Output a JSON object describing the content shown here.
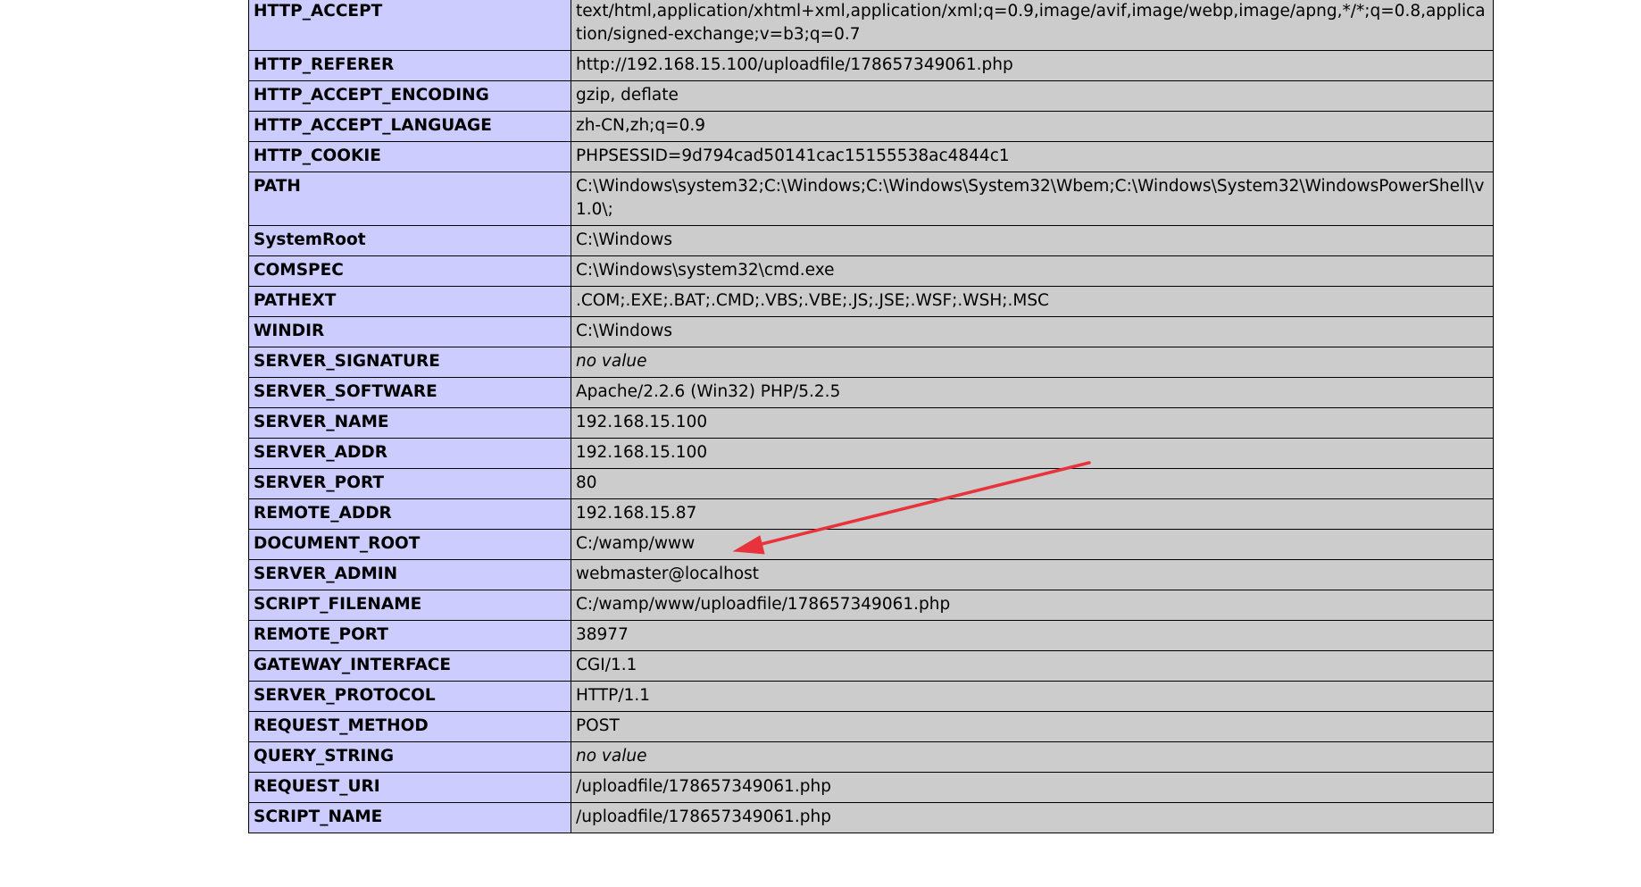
{
  "annotation": {
    "arrow_color": "#e8323c"
  },
  "colors": {
    "key_cell_bg": "#ccccff",
    "value_cell_bg": "#cccccc",
    "border": "#000000"
  },
  "rows": [
    {
      "key": "HTTP_ACCEPT",
      "value": "text/html,application/xhtml+xml,application/xml;q=0.9,image/avif,image/webp,image/apng,*/*;q=0.8,application/signed-exchange;v=b3;q=0.7",
      "no_value": false
    },
    {
      "key": "HTTP_REFERER",
      "value": "http://192.168.15.100/uploadfile/178657349061.php",
      "no_value": false
    },
    {
      "key": "HTTP_ACCEPT_ENCODING",
      "value": "gzip, deflate",
      "no_value": false
    },
    {
      "key": "HTTP_ACCEPT_LANGUAGE",
      "value": "zh-CN,zh;q=0.9",
      "no_value": false
    },
    {
      "key": "HTTP_COOKIE",
      "value": "PHPSESSID=9d794cad50141cac15155538ac4844c1",
      "no_value": false
    },
    {
      "key": "PATH",
      "value": "C:\\Windows\\system32;C:\\Windows;C:\\Windows\\System32\\Wbem;C:\\Windows\\System32\\WindowsPowerShell\\v1.0\\;",
      "no_value": false
    },
    {
      "key": "SystemRoot",
      "value": "C:\\Windows",
      "no_value": false
    },
    {
      "key": "COMSPEC",
      "value": "C:\\Windows\\system32\\cmd.exe",
      "no_value": false
    },
    {
      "key": "PATHEXT",
      "value": ".COM;.EXE;.BAT;.CMD;.VBS;.VBE;.JS;.JSE;.WSF;.WSH;.MSC",
      "no_value": false
    },
    {
      "key": "WINDIR",
      "value": "C:\\Windows",
      "no_value": false
    },
    {
      "key": "SERVER_SIGNATURE",
      "value": "no value",
      "no_value": true
    },
    {
      "key": "SERVER_SOFTWARE",
      "value": "Apache/2.2.6 (Win32) PHP/5.2.5",
      "no_value": false
    },
    {
      "key": "SERVER_NAME",
      "value": "192.168.15.100",
      "no_value": false
    },
    {
      "key": "SERVER_ADDR",
      "value": "192.168.15.100",
      "no_value": false
    },
    {
      "key": "SERVER_PORT",
      "value": "80",
      "no_value": false
    },
    {
      "key": "REMOTE_ADDR",
      "value": "192.168.15.87",
      "no_value": false
    },
    {
      "key": "DOCUMENT_ROOT",
      "value": "C:/wamp/www",
      "no_value": false
    },
    {
      "key": "SERVER_ADMIN",
      "value": "webmaster@localhost",
      "no_value": false
    },
    {
      "key": "SCRIPT_FILENAME",
      "value": "C:/wamp/www/uploadfile/178657349061.php",
      "no_value": false
    },
    {
      "key": "REMOTE_PORT",
      "value": "38977",
      "no_value": false
    },
    {
      "key": "GATEWAY_INTERFACE",
      "value": "CGI/1.1",
      "no_value": false
    },
    {
      "key": "SERVER_PROTOCOL",
      "value": "HTTP/1.1",
      "no_value": false
    },
    {
      "key": "REQUEST_METHOD",
      "value": "POST",
      "no_value": false
    },
    {
      "key": "QUERY_STRING",
      "value": "no value",
      "no_value": true
    },
    {
      "key": "REQUEST_URI",
      "value": "/uploadfile/178657349061.php",
      "no_value": false
    },
    {
      "key": "SCRIPT_NAME",
      "value": "/uploadfile/178657349061.php",
      "no_value": false
    }
  ]
}
